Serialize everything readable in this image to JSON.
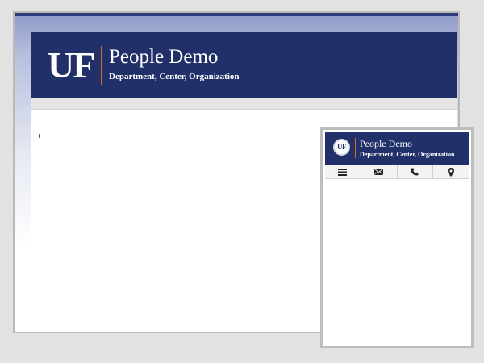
{
  "site": {
    "logo_text": "UF",
    "title": "People Demo",
    "subtitle": "Department, Center, Organization"
  },
  "mobile": {
    "logo_text": "UF",
    "title": "People Demo",
    "subtitle": "Department, Center, Organization",
    "tabs": [
      {
        "icon": "list-icon"
      },
      {
        "icon": "envelope-icon"
      },
      {
        "icon": "phone-icon"
      },
      {
        "icon": "map-marker-icon"
      }
    ]
  },
  "colors": {
    "brand_blue": "#22306a",
    "accent_orange": "#d9652b"
  }
}
